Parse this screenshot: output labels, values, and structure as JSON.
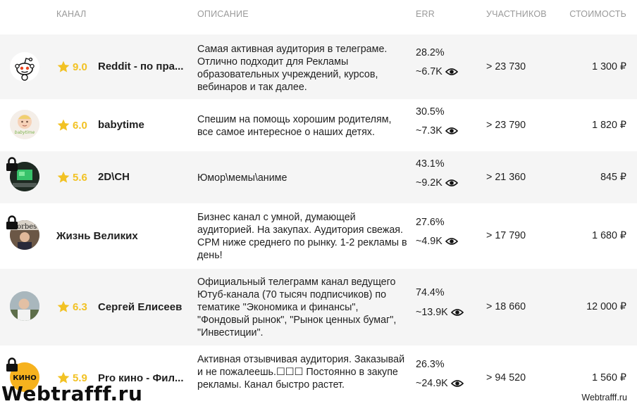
{
  "header": {
    "channel": "КАНАЛ",
    "description": "ОПИСАНИЕ",
    "err": "ERR",
    "members": "УЧАСТНИКОВ",
    "cost": "СТОИМОСТЬ"
  },
  "rows": [
    {
      "rating": "9.0",
      "name": "Reddit - по пра...",
      "description": "Самая активная аудитория в телеграме. Отлично подходит для Рекламы образовательных учреждений, курсов, вебинаров и так далее.",
      "err": "28.2%",
      "views": "~6.7K",
      "members": "> 23 730",
      "cost": "1 300 ₽",
      "avatar_icon": "reddit-alien-icon"
    },
    {
      "rating": "6.0",
      "name": "babytime",
      "description": "Спешим на помощь хорошим родителям, все самое интересное о наших детях.",
      "err": "30.5%",
      "views": "~7.3K",
      "members": "> 23 790",
      "cost": "1 820 ₽",
      "avatar_icon": "baby-photo-icon",
      "avatar_text": "babytime"
    },
    {
      "rating": "5.6",
      "name": "2D\\CH",
      "description": "Юмор\\мемы\\аниме",
      "err": "43.1%",
      "views": "~9.2K",
      "members": "> 21 360",
      "cost": "845 ₽",
      "avatar_icon": "monitor-photo-icon",
      "locked": true
    },
    {
      "name": "Жизнь Великих",
      "description": "Бизнес канал с умной, думающей аудиторией. На закупах. Аудитория свежая. CPM ниже среднего по рынку. 1-2 рекламы в день!",
      "err": "27.6%",
      "views": "~4.9K",
      "members": "> 17 790",
      "cost": "1 680 ₽",
      "avatar_icon": "forbes-photo-icon",
      "avatar_text": "Forbes",
      "locked": true
    },
    {
      "rating": "6.3",
      "name": "Сергей Елисеев",
      "description": "Официальный телеграмм канал ведущего Ютуб-канала (70 тысяч подписчиков) по тематике \"Экономика и финансы\", \"Фондовый рынок\", \"Рынок ценных бумаг\", \"Инвестиции\".",
      "err": "74.4%",
      "views": "~13.9K",
      "members": "> 18 660",
      "cost": "12 000 ₽",
      "avatar_icon": "person-photo-icon"
    },
    {
      "rating": "5.9",
      "name": "Pro кино - Фил...",
      "description": "Активная отзывчивая аудитория. Заказывай и не пожалеешь.☐☐☐ Постоянно в закупе рекламы. Канал быстро растет.",
      "err": "26.3%",
      "views": "~24.9K",
      "members": "> 94 520",
      "cost": "1 560 ₽",
      "avatar_icon": "kino-logo-icon",
      "avatar_text": "КИНО",
      "locked": true
    }
  ],
  "watermark": {
    "big": "Webtrafff.ru",
    "small": "Webtrafff.ru"
  },
  "colors": {
    "star": "#f2c224",
    "header_text": "#9a9a9a",
    "row_shade": "#f5f5f5"
  }
}
